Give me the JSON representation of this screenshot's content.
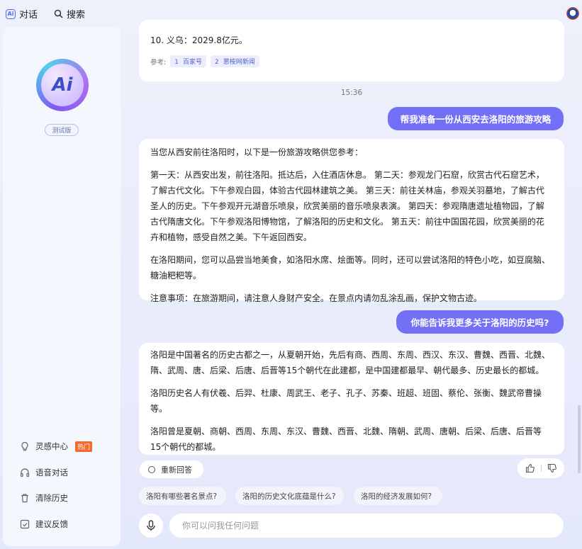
{
  "topbar": {
    "brand_logo": "Ai",
    "chat_label": "对话",
    "search_label": "搜索",
    "icons": {
      "search": "search-icon",
      "avatar": "user-avatar"
    }
  },
  "sidebar": {
    "logo_text": "Ai",
    "beta_label": "测试版",
    "items": [
      {
        "label": "灵感中心",
        "icon": "lightbulb-icon",
        "badge": "热门"
      },
      {
        "label": "语音对话",
        "icon": "headphones-icon"
      },
      {
        "label": "清除历史",
        "icon": "trash-icon"
      },
      {
        "label": "建议反馈",
        "icon": "feedback-icon"
      }
    ],
    "badge_color": "#f36b2b"
  },
  "chat": {
    "first_card": {
      "text": "10. 义乌：2029.8亿元。",
      "ref_label": "参考:",
      "refs": [
        {
          "num": "1",
          "label": "百家号"
        },
        {
          "num": "2",
          "label": "葱桉网新闻"
        }
      ]
    },
    "timestamp": "15:36",
    "user_msg_1": "帮我准备一份从西安去洛阳的旅游攻略",
    "ai_reply_1": [
      "当您从西安前往洛阳时，以下是一份旅游攻略供您参考：",
      "第一天：从西安出发，前往洛阳。抵达后，入住酒店休息。 第二天：参观龙门石窟，欣赏古代石窟艺术，了解古代文化。下午参观白园，体验古代园林建筑之美。 第三天：前往关林庙，参观关羽墓地，了解古代圣人的历史。下午参观开元湖音乐喷泉，欣赏美丽的音乐喷泉表演。 第四天：参观隋唐遗址植物园，了解古代隋唐文化。下午参观洛阳博物馆，了解洛阳的历史和文化。 第五天：前往中国国花园，欣赏美丽的花卉和植物，感受自然之美。下午返回西安。",
      "在洛阳期间，您可以品尝当地美食，如洛阳水席、烩面等。同时，还可以尝试洛阳的特色小吃，如豆腐脑、糖油粑粑等。",
      "注意事项：在旅游期间，请注意人身财产安全。在景点内请勿乱涂乱画，保护文物古迹。"
    ],
    "user_msg_2": "你能告诉我更多关于洛阳的历史吗?",
    "ai_reply_2": [
      "洛阳是中国著名的历史古都之一，从夏朝开始，先后有商、西周、东周、西汉、东汉、曹魏、西晋、北魏、隋、武周、唐、后梁、后唐、后晋等15个朝代在此建都，是中国建都最早、朝代最多、历史最长的都城。",
      "洛阳历史名人有伏羲、后羿、杜康、周武王、老子、孔子、苏秦、班超、班固、蔡伦、张衡、魏武帝曹操等。",
      "洛阳曾是夏朝、商朝、西周、东周、东汉、曹魏、西晋、北魏、隋朝、武周、唐朝、后梁、后唐、后晋等15个朝代的都城。"
    ],
    "regenerate_label": "重新回答",
    "feedback_icons": {
      "like": "thumbs-up-icon",
      "dislike": "thumbs-down-icon"
    },
    "suggestions": [
      "洛阳有哪些著名景点?",
      "洛阳的历史文化底蕴是什么?",
      "洛阳的经济发展如何?"
    ],
    "input_placeholder": "你可以问我任何问题",
    "accent_color": "#7370f5"
  }
}
